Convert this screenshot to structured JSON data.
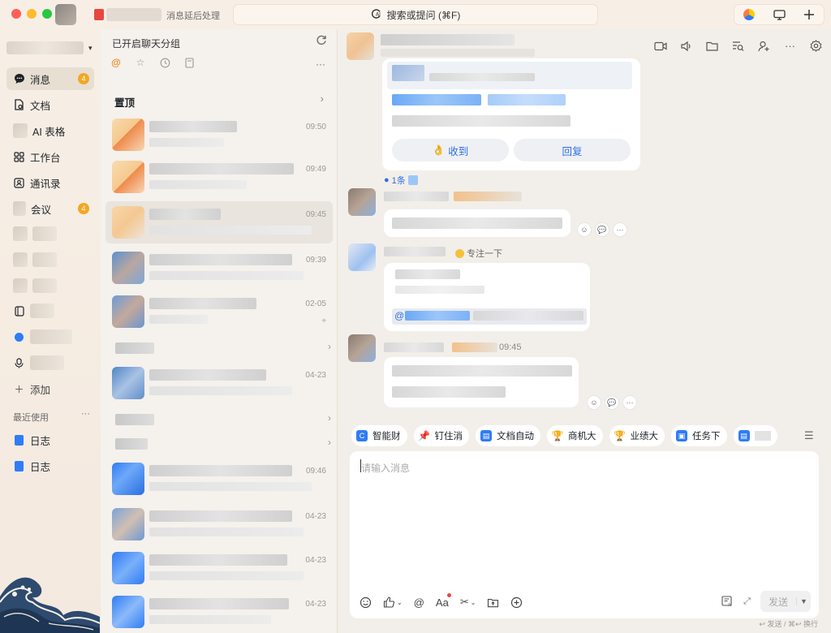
{
  "titlebar": {
    "notice_text": "消息延后处理",
    "search_label": "搜索或提问 (⌘F)",
    "search_icon": "ai-search-icon",
    "right_icons": [
      "ai-assistant-icon",
      "screen-share-icon",
      "plus-icon"
    ]
  },
  "nav": {
    "items": [
      {
        "label": "消息",
        "icon": "message-icon",
        "badge": "4",
        "active": true
      },
      {
        "label": "文档",
        "icon": "document-icon"
      },
      {
        "label": "AI 表格",
        "icon": "ai-table-icon"
      },
      {
        "label": "工作台",
        "icon": "workbench-icon"
      },
      {
        "label": "通讯录",
        "icon": "contacts-icon"
      },
      {
        "label": "会议",
        "icon": "meeting-icon",
        "badge": "4"
      }
    ],
    "add_label": "添加",
    "recent_label": "最近使用",
    "recent_more": "···",
    "recent_items": [
      {
        "label": "日志",
        "icon": "log-doc-icon"
      },
      {
        "label": "日志",
        "icon": "log-doc-icon"
      }
    ]
  },
  "chatlist": {
    "title": "已开启聊天分组",
    "pinned_label": "置顶",
    "more": "···",
    "tabs": [
      "mention-icon",
      "star-icon",
      "clock-icon",
      "doc-icon"
    ],
    "chats": [
      {
        "time": "09:50"
      },
      {
        "time": "09:49"
      },
      {
        "time": "09:45",
        "selected": true
      },
      {
        "time": "09:39",
        "tail": "|"
      },
      {
        "time": "02-05"
      },
      {
        "time": "04-23",
        "tail": "(兰..."
      },
      {
        "time": "09:46"
      },
      {
        "time": "04-23"
      },
      {
        "time": "04-23"
      },
      {
        "time": "04-23"
      }
    ]
  },
  "chatpanel": {
    "header_tools": [
      "video-call-icon",
      "voice-icon",
      "folder-icon",
      "search-chat-icon",
      "add-member-icon",
      "more-icon",
      "settings-icon"
    ],
    "card": {
      "received_label": "收到",
      "reply_label": "回复"
    },
    "reply_count": "1条",
    "status_tag": "专注一下",
    "mention_prefix": "@",
    "msg_time": "09:45",
    "chips": [
      {
        "label": "智能财",
        "icon": "smart-finance-icon",
        "color": "#2f7cf6"
      },
      {
        "label": "钉住消",
        "icon": "pin-message-icon",
        "color": "#2f7cf6"
      },
      {
        "label": "文档自动",
        "icon": "doc-auto-icon",
        "color": "#2f7cf6"
      },
      {
        "label": "商机大",
        "icon": "trophy-icon",
        "color": "#f5b400"
      },
      {
        "label": "业绩大",
        "icon": "trophy-icon",
        "color": "#f5b400"
      },
      {
        "label": "任务下",
        "icon": "task-icon",
        "color": "#2f7cf6"
      }
    ],
    "composer": {
      "placeholder": "请输入消息",
      "send_label": "发送",
      "hint": "↩ 发送 / ⌘↩ 换行"
    }
  },
  "colors": {
    "accent": "#2f6fe4",
    "badge": "#f5a623",
    "selected_row": "#e9e4de"
  }
}
